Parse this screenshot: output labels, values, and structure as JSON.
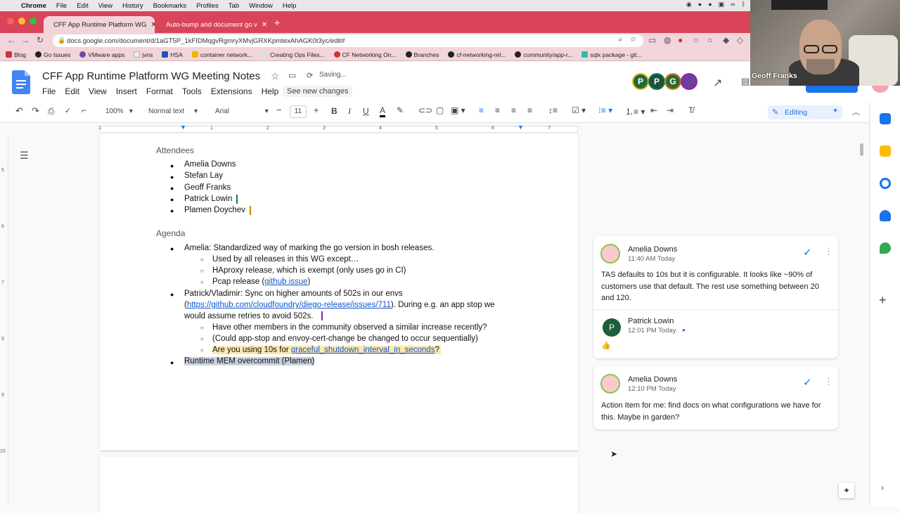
{
  "mac_menu": {
    "app": "Chrome",
    "items": [
      "File",
      "Edit",
      "View",
      "History",
      "Bookmarks",
      "Profiles",
      "Tab",
      "Window",
      "Help"
    ]
  },
  "tabs": [
    {
      "title": "CFF App Runtime Platform WG",
      "active": true
    },
    {
      "title": "Auto-bump and document go v",
      "active": false
    }
  ],
  "url": "docs.google.com/document/d/1aGT5P_1kFIDMqgvRgmryXMvjGRXKpmtexAhAGK0t3yc/edit#",
  "bookmarks": [
    "Blog",
    "Go Issues",
    "VMware apps",
    "jvns",
    "HSA",
    "container network...",
    "Creating Ops Files...",
    "CF Networking On...",
    "Branches",
    "cf-networking-rel...",
    "community/app-r...",
    "sqlx package - git..."
  ],
  "doc": {
    "title": "CFF App Runtime Platform WG Meeting Notes",
    "saving": "Saving...",
    "menus": [
      "File",
      "Edit",
      "View",
      "Insert",
      "Format",
      "Tools",
      "Extensions",
      "Help"
    ],
    "see_new_changes": "See new changes"
  },
  "collaborators": [
    {
      "initial": "P",
      "color": "#1e6b3a"
    },
    {
      "initial": "P",
      "color": "#1e4f3f"
    },
    {
      "initial": "G",
      "color": "#2f6b2f"
    },
    {
      "initial": "",
      "color": "#6b3fa0"
    }
  ],
  "toolbar": {
    "zoom": "100%",
    "style": "Normal text",
    "font": "Arial",
    "size": "11",
    "mode": "Editing"
  },
  "ruler_numbers": [
    "1",
    "1",
    "2",
    "3",
    "4",
    "5",
    "6",
    "7"
  ],
  "vruler_numbers": [
    "5",
    "6",
    "7",
    "8",
    "9",
    "10"
  ],
  "page": {
    "attendees_heading": "Attendees",
    "attendees": [
      "Amelia Downs",
      "Stefan Lay",
      "Geoff Franks",
      "Patrick Lowin",
      "Plamen Doychev"
    ],
    "agenda_heading": "Agenda",
    "agenda1": "Amelia: Standardized way of marking the go version in bosh releases.",
    "agenda1_sub": [
      "Used by all releases in this WG except…",
      "HAproxy release, which is exempt (only uses go in CI)"
    ],
    "agenda1_pcap_pre": "Pcap release (",
    "agenda1_pcap_link": "github issue",
    "agenda1_pcap_post": ")",
    "agenda2_line1": "Patrick/Vladimir: Sync on higher amounts of 502s in our envs",
    "agenda2_link": "https://github.com/cloudfoundry/diego-release/issues/711",
    "agenda2_line2_post": "). During e.g. an app stop we",
    "agenda2_line3": "would assume retries to avoid 502s.",
    "agenda2_sub1": "Have other members in the community observed a similar increase recently?",
    "agenda2_sub2": "(Could app-stop and envoy-cert-change be changed to occur sequentially)",
    "agenda2_sub3_pre": "Are you using 10s for ",
    "agenda2_sub3_link": "graceful_shutdown_interval_in_seconds",
    "agenda2_sub3_post": "?",
    "agenda3": "Runtime MEM overcommit (Plamen)"
  },
  "comments": [
    {
      "author": "Amelia Downs",
      "time": "11:40 AM Today",
      "text": "TAS defaults to 10s but it is configurable. It looks like ~90% of customers use that default. The rest use something between 20 and 120.",
      "reply": {
        "author": "Patrick Lowin",
        "initial": "P",
        "time": "12:01 PM Today",
        "text": "👍"
      }
    },
    {
      "author": "Amelia Downs",
      "time": "12:10 PM Today",
      "text": "Action Item for me: find docs on what configurations we have for this. Maybe in garden?"
    }
  ],
  "webcam": {
    "name": "Geoff Franks"
  }
}
